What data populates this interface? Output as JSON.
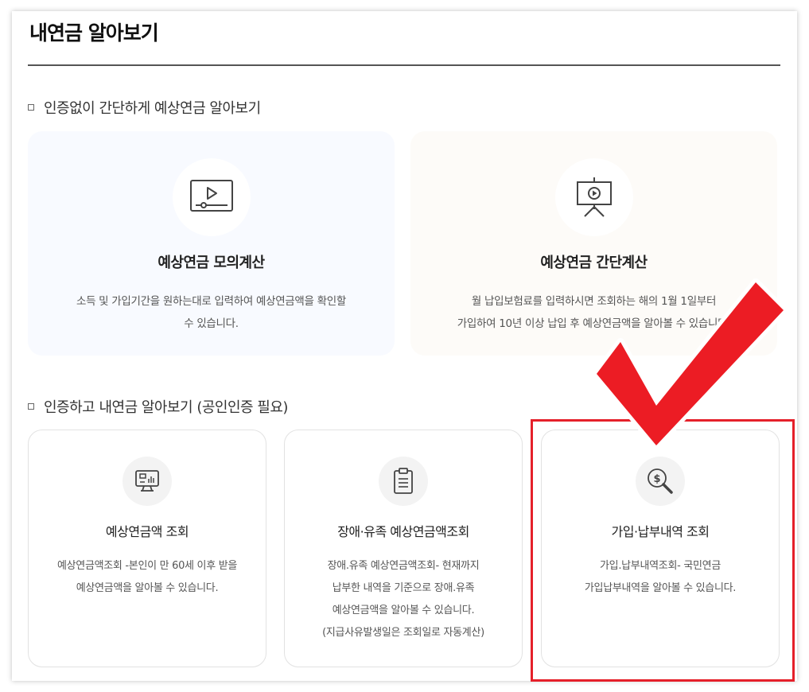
{
  "page_title": "내연금 알아보기",
  "section1": {
    "title": "인증없이 간단하게 예상연금 알아보기",
    "cards": [
      {
        "title": "예상연금 모의계산",
        "desc_lines": [
          "소득 및 가입기간을 원하는대로 입력하여 예상연금액을 확인할",
          "수 있습니다."
        ],
        "icon": "video-play-icon"
      },
      {
        "title": "예상연금 간단계산",
        "desc_lines": [
          "월 납입보험료를 입력하시면 조회하는 해의 1월 1일부터",
          "가입하여 10년 이상 납입 후 예상연금액을 알아볼 수 있습니다."
        ],
        "icon": "presentation-board-icon"
      }
    ]
  },
  "section2": {
    "title": "인증하고 내연금 알아보기 (공인인증 필요)",
    "cards": [
      {
        "title": "예상연금액 조회",
        "desc_lines": [
          "예상연금액조회 -본인이 만 60세 이후 받을",
          "예상연금액을 알아볼 수 있습니다."
        ],
        "icon": "monitor-chart-icon"
      },
      {
        "title": "장애·유족 예상연금액조회",
        "desc_lines": [
          "장애.유족 예상연금액조회- 현재까지",
          "납부한 내역을 기준으로 장애.유족",
          "예상연금액을 알아볼 수 있습니다.",
          "(지급사유발생일은 조회일로 자동계산)"
        ],
        "icon": "clipboard-icon"
      },
      {
        "title": "가입·납부내역 조회",
        "desc_lines": [
          "가입.납부내역조회- 국민연금",
          "가입납부내역을 알아볼 수 있습니다."
        ],
        "icon": "dollar-search-icon"
      }
    ]
  },
  "colors": {
    "highlight": "#e5202a",
    "card_blue": "#f8faff",
    "card_beige": "#fdfbf8"
  }
}
